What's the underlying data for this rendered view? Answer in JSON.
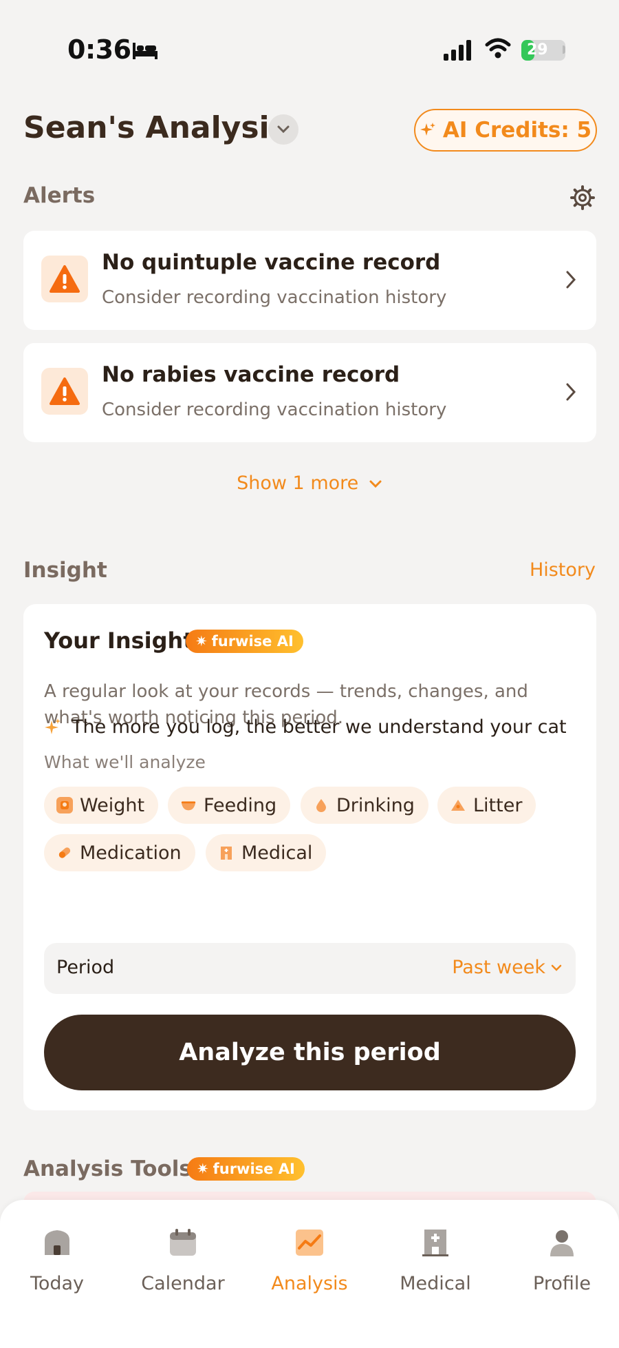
{
  "status_bar": {
    "time": "0:36",
    "battery": "29",
    "battery_level": 0.29
  },
  "header": {
    "title": "Sean's Analysis",
    "credits_label": "AI Credits: 5"
  },
  "alerts": {
    "section_label": "Alerts",
    "items": [
      {
        "title": "No quintuple vaccine record",
        "subtitle": "Consider recording vaccination history"
      },
      {
        "title": "No rabies vaccine record",
        "subtitle": "Consider recording vaccination history"
      }
    ],
    "show_more": "Show 1 more"
  },
  "insight": {
    "section_label": "Insight",
    "history_link": "History",
    "card_title": "Your Insight",
    "badge": "furwise AI",
    "description": "A regular look at your records — trends, changes, and what's worth noticing this period.",
    "analyze_label": "What we'll analyze",
    "chips": [
      "Weight",
      "Feeding",
      "Drinking",
      "Litter",
      "Medication",
      "Medical"
    ],
    "tip": "The more you log, the better we understand your cat",
    "period_label": "Period",
    "period_value": "Past week",
    "analyze_button": "Analyze this period"
  },
  "tools": {
    "section_label": "Analysis Tools",
    "badge": "furwise AI"
  },
  "tab_bar": {
    "tabs": [
      {
        "label": "Today",
        "icon": "home-icon"
      },
      {
        "label": "Calendar",
        "icon": "calendar-icon"
      },
      {
        "label": "Analysis",
        "icon": "chart-icon"
      },
      {
        "label": "Medical",
        "icon": "hospital-icon"
      },
      {
        "label": "Profile",
        "icon": "person-icon"
      }
    ],
    "active": "Analysis"
  },
  "colors": {
    "accent": "#f28a1c",
    "dark_button": "#3d2b1f",
    "background": "#f4f3f2"
  }
}
